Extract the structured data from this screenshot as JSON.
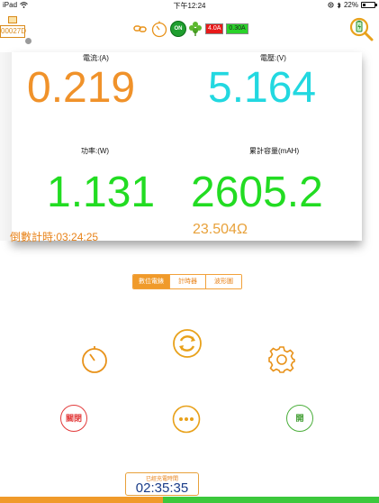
{
  "status_bar": {
    "device": "iPad",
    "time": "下午12:24",
    "battery": "22%",
    "battery_level": 0.22
  },
  "device_id": "00027D",
  "toolbar": {
    "on_label": "ON",
    "limit_current": "4.0A",
    "limit_current_low": "0.30A"
  },
  "readings": {
    "current_label": "電流:(A)",
    "current_value": "0.219",
    "voltage_label": "電壓:(V)",
    "voltage_value": "5.164",
    "power_label": "功率:(W)",
    "power_value": "1.131",
    "capacity_label": "累計容量(mAH)",
    "capacity_value": "2605.2",
    "countdown": "倒數計時:03:24:25",
    "resistance": "23.504Ω"
  },
  "tabs": [
    {
      "label": "數位電錶",
      "active": true
    },
    {
      "label": "計時器",
      "active": false
    },
    {
      "label": "波形圖",
      "active": false
    }
  ],
  "controls": {
    "close_label": "關閉",
    "open_label": "開"
  },
  "charge": {
    "label": "已經充電時間",
    "time": "02:35:35",
    "progress_split": 0.43
  },
  "colors": {
    "orange": "#f0922a",
    "cyan": "#22d8e0",
    "green": "#22dc22",
    "red": "#e23a3a"
  }
}
